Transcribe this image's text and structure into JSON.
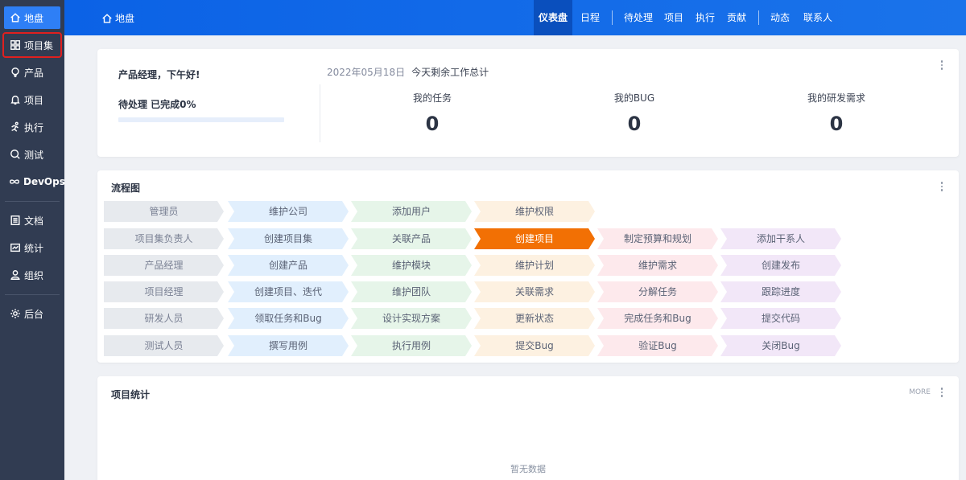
{
  "sidebar": {
    "items": [
      {
        "label": "地盘",
        "icon": "home-icon"
      },
      {
        "label": "项目集",
        "icon": "grid-icon"
      },
      {
        "label": "产品",
        "icon": "lightbulb-icon"
      },
      {
        "label": "项目",
        "icon": "bell-icon"
      },
      {
        "label": "执行",
        "icon": "run-icon"
      },
      {
        "label": "测试",
        "icon": "search-icon"
      },
      {
        "label": "DevOps",
        "icon": "infinity-icon"
      },
      {
        "label": "文档",
        "icon": "doc-icon"
      },
      {
        "label": "统计",
        "icon": "chart-icon"
      },
      {
        "label": "组织",
        "icon": "user-icon"
      },
      {
        "label": "后台",
        "icon": "gear-icon"
      }
    ]
  },
  "header": {
    "breadcrumb": "地盘",
    "nav": [
      "仪表盘",
      "日程",
      "待处理",
      "项目",
      "执行",
      "贡献",
      "动态",
      "联系人"
    ]
  },
  "welcome": {
    "greeting": "产品经理，下午好!",
    "pending": "待处理 已完成0%",
    "progress": 0,
    "date": "2022年05月18日",
    "summary_title": "今天剩余工作总计",
    "stats": [
      {
        "label": "我的任务",
        "value": "0"
      },
      {
        "label": "我的BUG",
        "value": "0"
      },
      {
        "label": "我的研发需求",
        "value": "0"
      }
    ]
  },
  "flow": {
    "title": "流程图",
    "rows": [
      [
        "管理员",
        "维护公司",
        "添加用户",
        "维护权限"
      ],
      [
        "项目集负责人",
        "创建项目集",
        "关联产品",
        "创建项目",
        "制定预算和规划",
        "添加干系人"
      ],
      [
        "产品经理",
        "创建产品",
        "维护模块",
        "维护计划",
        "维护需求",
        "创建发布"
      ],
      [
        "项目经理",
        "创建项目、迭代",
        "维护团队",
        "关联需求",
        "分解任务",
        "跟踪进度"
      ],
      [
        "研发人员",
        "领取任务和Bug",
        "设计实现方案",
        "更新状态",
        "完成任务和Bug",
        "提交代码"
      ],
      [
        "测试人员",
        "撰写用例",
        "执行用例",
        "提交Bug",
        "验证Bug",
        "关闭Bug"
      ]
    ],
    "active": "创建项目",
    "colors": {
      "active": "#f27004",
      "role": "#e7eaee",
      "col1": "#e1effd",
      "col2": "#e6f5e9",
      "col3": "#fdf1e1",
      "col4": "#fde9ec",
      "col5": "#f2e7f8"
    }
  },
  "project_stats": {
    "title": "项目统计",
    "more": "MORE",
    "empty": "暂无数据"
  }
}
